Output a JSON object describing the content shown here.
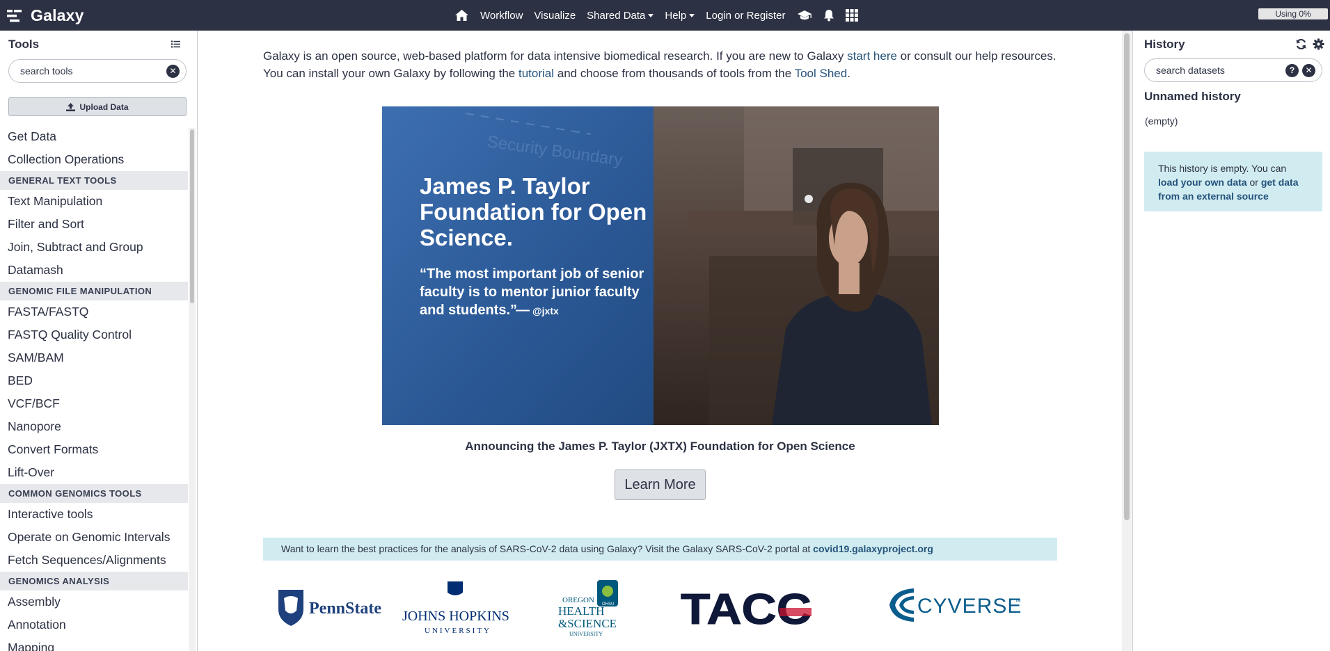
{
  "masthead": {
    "brand": "Galaxy",
    "nav": {
      "workflow": "Workflow",
      "visualize": "Visualize",
      "shared_data": "Shared Data",
      "help": "Help",
      "login": "Login or Register"
    },
    "quota": "Using 0%",
    "icons": [
      "menu-grid-icon",
      "home-icon",
      "graduation-cap-icon",
      "bell-icon",
      "apps-grid-icon"
    ]
  },
  "tools": {
    "title": "Tools",
    "search_placeholder": "search tools",
    "upload_label": "Upload Data",
    "sections": [
      "Get Data",
      "Collection Operations"
    ],
    "groups": [
      {
        "label": "GENERAL TEXT TOOLS",
        "items": [
          "Text Manipulation",
          "Filter and Sort",
          "Join, Subtract and Group",
          "Datamash"
        ]
      },
      {
        "label": "GENOMIC FILE MANIPULATION",
        "items": [
          "FASTA/FASTQ",
          "FASTQ Quality Control",
          "SAM/BAM",
          "BED",
          "VCF/BCF",
          "Nanopore",
          "Convert Formats",
          "Lift-Over"
        ]
      },
      {
        "label": "COMMON GENOMICS TOOLS",
        "items": [
          "Interactive tools",
          "Operate on Genomic Intervals",
          "Fetch Sequences/Alignments"
        ]
      },
      {
        "label": "GENOMICS ANALYSIS",
        "items": [
          "Assembly",
          "Annotation",
          "Mapping"
        ]
      }
    ]
  },
  "center": {
    "intro": {
      "brand": "Galaxy",
      "t1": " is an open source, web-based platform for data intensive biomedical research. If you are new to Galaxy ",
      "link1": "start here",
      "t2": " or consult our help resources. You can install your own Galaxy by following the ",
      "link2": "tutorial",
      "t3": " and choose from thousands of tools from the ",
      "link3": "Tool Shed",
      "t4": "."
    },
    "banner": {
      "bg_text": "Security Boundary",
      "title_lines": [
        "James P. Taylor",
        "Foundation for Open",
        "Science."
      ],
      "quote_lines": [
        "“The most important job of senior",
        "faculty is to mentor junior faculty",
        "and students.”"
      ],
      "quote_dash": "—",
      "quote_handle": "@jxtx"
    },
    "caption": "Announcing the James P. Taylor (JXTX) Foundation for Open Science",
    "learn_more": "Learn More",
    "notice_text": "Want to learn the best practices for the analysis of SARS-CoV-2 data using Galaxy? Visit the Galaxy SARS-CoV-2 portal at ",
    "notice_link": "covid19.galaxyproject.org",
    "logos": {
      "pennstate": "PennState",
      "jhu_1": "JOHNS HOPKINS",
      "jhu_2": "UNIVERSITY",
      "ohsu_1": "OREGON",
      "ohsu_2": "HEALTH",
      "ohsu_3": "&SCIENCE",
      "ohsu_4": "UNIVERSITY",
      "ohsu_badge": "OHSU",
      "tacc": "TACC",
      "cyverse": "CYVERSE",
      "cyverse_mark": "™"
    }
  },
  "history": {
    "title": "History",
    "search_placeholder": "search datasets",
    "name": "Unnamed history",
    "empty": "(empty)",
    "msg_text1": "This history is empty. You can ",
    "msg_link1": "load your own data",
    "msg_text2": " or ",
    "msg_link2": "get data from an external source"
  },
  "colors": {
    "masthead_bg": "#2c3143",
    "link": "#25537b",
    "info_bg": "#d1ecf1",
    "section_label_bg": "#e6e8ec"
  }
}
